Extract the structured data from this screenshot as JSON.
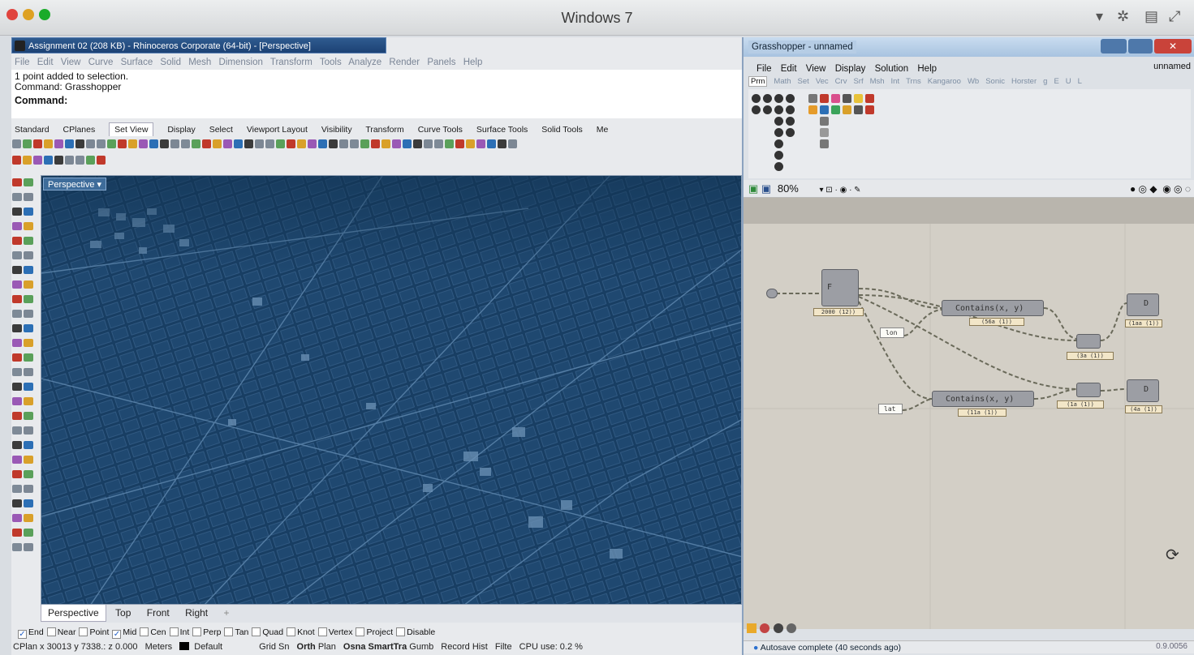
{
  "mac": {
    "title": "Windows 7",
    "traffic_colors": [
      "#e0443e",
      "#dea123",
      "#1aab29"
    ]
  },
  "rhino": {
    "window_title": "Assignment 02 (208 KB) - Rhinoceros Corporate (64-bit) - [Perspective]",
    "menu": [
      "File",
      "Edit",
      "View",
      "Curve",
      "Surface",
      "Solid",
      "Mesh",
      "Dimension",
      "Transform",
      "Tools",
      "Analyze",
      "Render",
      "Panels",
      "Help"
    ],
    "command_history": [
      "1 point added to selection.",
      "Command: Grasshopper"
    ],
    "command_label": "Command:",
    "tabs": [
      "Standard",
      "CPlanes",
      "Set View",
      "Display",
      "Select",
      "Viewport Layout",
      "Visibility",
      "Transform",
      "Curve Tools",
      "Surface Tools",
      "Solid Tools",
      "Me"
    ],
    "active_tab": "Set View",
    "viewport_label": "Perspective",
    "viewport_tabs": [
      "Perspective",
      "Top",
      "Front",
      "Right"
    ],
    "viewport_add": "+",
    "osnaps": [
      {
        "label": "End",
        "checked": true
      },
      {
        "label": "Near",
        "checked": false
      },
      {
        "label": "Point",
        "checked": false
      },
      {
        "label": "Mid",
        "checked": true
      },
      {
        "label": "Cen",
        "checked": false
      },
      {
        "label": "Int",
        "checked": false
      },
      {
        "label": "Perp",
        "checked": false
      },
      {
        "label": "Tan",
        "checked": false
      },
      {
        "label": "Quad",
        "checked": false
      },
      {
        "label": "Knot",
        "checked": false
      },
      {
        "label": "Vertex",
        "checked": false
      },
      {
        "label": "Project",
        "checked": false
      },
      {
        "label": "Disable",
        "checked": false
      }
    ],
    "status": {
      "coords": "CPlan x 30013 y 7338.: z 0.000",
      "units": "Meters",
      "layer": "Default",
      "grid": "Grid Sn",
      "ortho": "Orth",
      "planar": "Plan",
      "osnap": "Osna",
      "smarttrack": "SmartTra",
      "gumball": "Gumb",
      "record": "Record Hist",
      "filter": "Filte",
      "cpu": "CPU use: 0.2 %"
    },
    "viewport_color": "#183e63"
  },
  "grasshopper": {
    "window_title": "Grasshopper - unnamed",
    "menu": [
      "File",
      "Edit",
      "View",
      "Display",
      "Solution",
      "Help"
    ],
    "doc_name": "unnamed",
    "categories": [
      "Prm",
      "Math",
      "Set",
      "Vec",
      "Crv",
      "Srf",
      "Msh",
      "Int",
      "Trns",
      "Kangaroo",
      "Wb",
      "Sonic",
      "Horster",
      "g",
      "E",
      "U",
      "L"
    ],
    "active_category": "Prm",
    "zoom": "80%",
    "nodes": {
      "contains1": "Contains(x, y)",
      "contains2": "Contains(x, y)",
      "panel_lon": "lon",
      "panel_lat": "lat"
    },
    "node_labels": [
      "2000 (12))",
      "(56a (1))",
      "(3a (1))",
      "(1a (1))",
      "(1aa (1))",
      "(1aa (1))",
      "(11a (1))",
      "(4a (1))"
    ],
    "status": "Autosave complete (40 seconds ago)",
    "version": "0.9.0056",
    "canvas_color": "#d3cfc6"
  }
}
